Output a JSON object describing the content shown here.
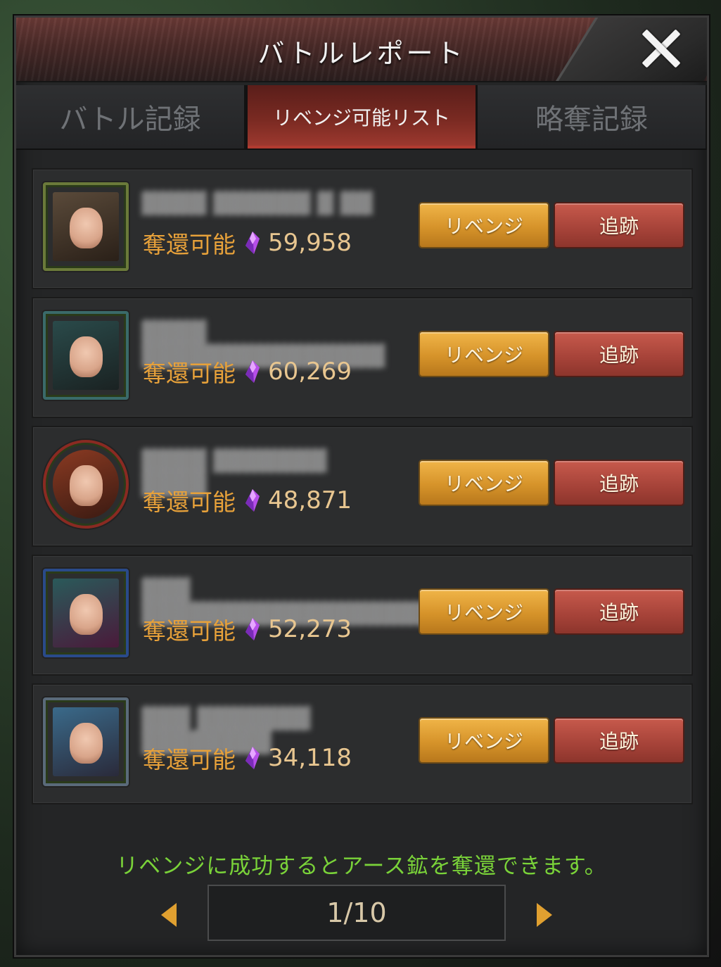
{
  "window": {
    "title": "バトルレポート"
  },
  "tabs": [
    {
      "label": "バトル記録",
      "active": false
    },
    {
      "label": "リベンジ可能リスト",
      "active": true
    },
    {
      "label": "略奪記録",
      "active": false
    }
  ],
  "entries": [
    {
      "steal_label": "奪還可能",
      "amount": "59,958",
      "revenge_label": "リベンジ",
      "track_label": "追跡",
      "avatar_color": "#6b7a3a"
    },
    {
      "steal_label": "奪還可能",
      "amount": "60,269",
      "revenge_label": "リベンジ",
      "track_label": "追跡",
      "avatar_color": "#3a6a6a"
    },
    {
      "steal_label": "奪還可能",
      "amount": "48,871",
      "revenge_label": "リベンジ",
      "track_label": "追跡",
      "avatar_color": "#8a2a22"
    },
    {
      "steal_label": "奪還可能",
      "amount": "52,273",
      "revenge_label": "リベンジ",
      "track_label": "追跡",
      "avatar_color": "#2a4a8a"
    },
    {
      "steal_label": "奪還可能",
      "amount": "34,118",
      "revenge_label": "リベンジ",
      "track_label": "追跡",
      "avatar_color": "#5a6a7a"
    }
  ],
  "hint": "リベンジに成功するとアース鉱を奪還できます。",
  "pagination": {
    "current": "1/10"
  },
  "icons": {
    "close": "close-icon",
    "crystal": "purple-crystal-icon",
    "prev": "triangle-left-icon",
    "next": "triangle-right-icon"
  },
  "colors": {
    "accent_gold": "#e0a030",
    "revenge_button": "#d6932a",
    "track_button": "#a8443a",
    "hint_green": "#7ad339",
    "steal_label": "#e7a13a"
  }
}
